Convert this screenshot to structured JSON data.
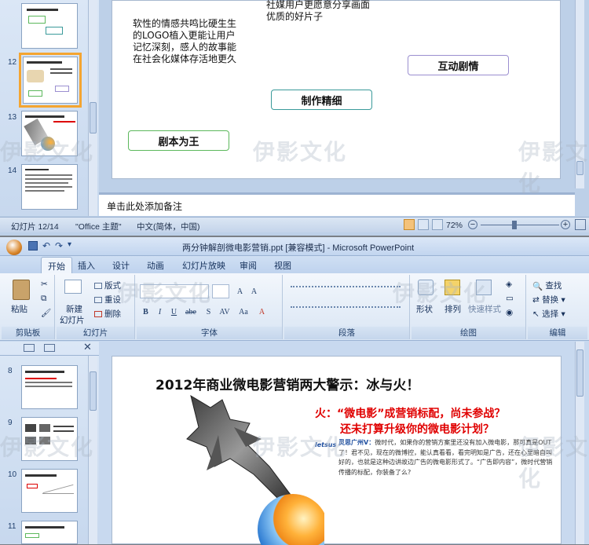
{
  "top_window": {
    "thumbnails": [
      {
        "number": ""
      },
      {
        "number": "12"
      },
      {
        "number": "13"
      },
      {
        "number": "14"
      }
    ],
    "slide": {
      "text_left": "软性的情感共鸣比硬生生的LOGO植入更能让用户记忆深刻，感人的故事能在社会化媒体存活地更久",
      "text_right": "社媒用户更愿意分享画面优质的好片子",
      "box_interactive": "互动剧情",
      "box_production": "制作精细",
      "box_script": "剧本为王"
    },
    "notes_placeholder": "单击此处添加备注",
    "status": {
      "slide_count": "幻灯片 12/14",
      "theme": "\"Office 主题\"",
      "language": "中文(简体，中国)",
      "zoom": "72%"
    }
  },
  "bottom_window": {
    "title": "两分钟解剖微电影营销.ppt [兼容模式] - Microsoft PowerPoint",
    "tabs": [
      "开始",
      "插入",
      "设计",
      "动画",
      "幻灯片放映",
      "审阅",
      "视图"
    ],
    "ribbon": {
      "paste": "粘贴",
      "new_slide_1": "新建",
      "new_slide_2": "幻灯片",
      "layout": "版式",
      "reset": "重设",
      "delete": "删除",
      "shape": "形状",
      "arrange": "排列",
      "quick_styles": "快速样式",
      "find": "查找",
      "replace": "替换",
      "select": "选择",
      "groups": {
        "clipboard": "剪贴板",
        "slides": "幻灯片",
        "font": "字体",
        "paragraph": "段落",
        "drawing": "绘图",
        "editing": "编辑"
      },
      "font_buttons": [
        "B",
        "I",
        "U",
        "abe",
        "S",
        "AV",
        "Aa",
        "A"
      ]
    },
    "thumbnails": [
      {
        "number": "8"
      },
      {
        "number": "9"
      },
      {
        "number": "10"
      },
      {
        "number": "11"
      }
    ],
    "slide": {
      "title": "2012年商业微电影营销两大警示：冰与火！",
      "red_heading_1": "火：“微电影”成营销标配，尚未参战？",
      "red_heading_2": "还未打算升级你的微电影计划？",
      "body_lead": "灵思广州V：",
      "body_text": "微时代，如果你的营销方案里还没有加入微电影，那可真是OUT了！君不见，现在的微博控，能认真看看，看完明知是广告，还在心里暗自叫好的，也就是这种边讲故边广告的微电影形式了。“广告即内容”，微时代营销传播的标配，你装备了么?",
      "logo_text": "letsus"
    },
    "watermark": "伊影文化"
  },
  "colors": {
    "accent_orange": "#f4a531",
    "red_text": "#e00000",
    "green_border": "#5cb85c",
    "teal_border": "#3a9a9a",
    "purple_border": "#9b8fd0"
  }
}
